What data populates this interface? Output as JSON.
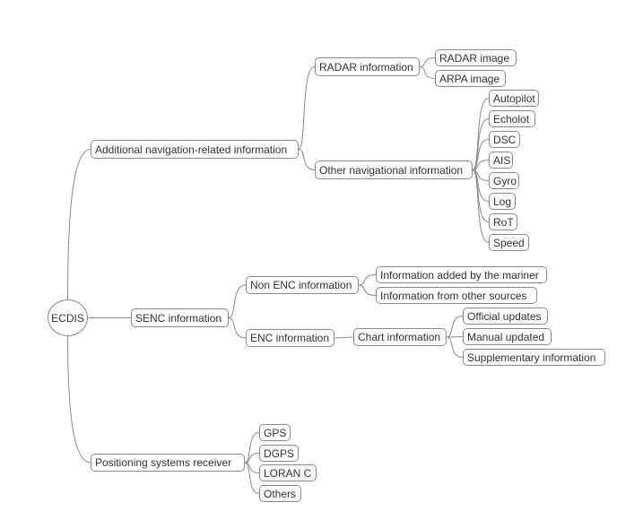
{
  "mindmap": {
    "root": "ECDIS",
    "nodes": {
      "add": "Additional navigation-related information",
      "radar": "RADAR information",
      "radarimg": "RADAR image",
      "arpa": "ARPA image",
      "other": "Other navigational information",
      "autopilot": "Autopilot",
      "echolot": "Echolot",
      "dsc": "DSC",
      "ais": "AIS",
      "gyro": "Gyro",
      "log": "Log",
      "rot": "RoT",
      "speed": "Speed",
      "senc": "SENC information",
      "nonenc": "Non ENC information",
      "mariner": "Information added by the mariner",
      "othersrc": "Information from other sources",
      "enc": "ENC information",
      "chart": "Chart information",
      "official": "Official updates",
      "manual": "Manual updated",
      "supp": "Supplementary information",
      "pos": "Positioning systems receiver",
      "gps": "GPS",
      "dgps": "DGPS",
      "loran": "LORAN C",
      "others": "Others"
    }
  },
  "colors": {
    "line": "#8a8a8a",
    "text": "#333333"
  }
}
